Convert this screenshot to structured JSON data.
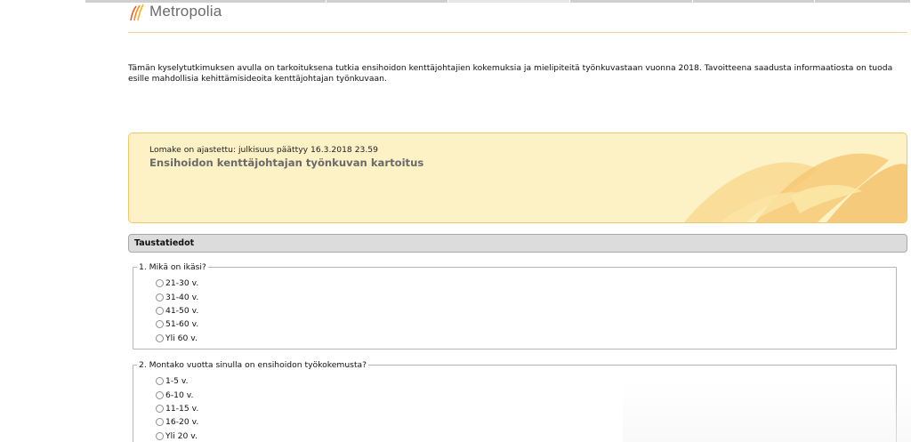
{
  "brand": {
    "name": "Metropolia",
    "accent": "#f0a81e",
    "logo_icon": "metropolia-flame-icon"
  },
  "intro": {
    "text": "Tämän kyselytutkimuksen avulla on tarkoituksena tutkia ensihoidon kenttäjohtajien kokemuksia ja mielipiteitä työnkuvastaan vuonna 2018. Tavoitteena saadusta informaatiosta on tuoda esille mahdollisia kehittämisideoita kenttäjohtajan työnkuvaan."
  },
  "banner": {
    "schedule": "Lomake on ajastettu: julkisuus päättyy 16.3.2018 23.59",
    "title": "Ensihoidon kenttäjohtajan työnkuvan kartoitus",
    "bg": "#fdf1c6"
  },
  "section": {
    "title": "Taustatiedot"
  },
  "questions": [
    {
      "label": "1. Mikä on ikäsi?",
      "options": [
        "21-30 v.",
        "31-40 v.",
        "41-50 v.",
        "51-60 v.",
        "Yli 60 v."
      ]
    },
    {
      "label": "2. Montako vuotta sinulla on ensihoidon työkokemusta?",
      "options": [
        "1-5 v.",
        "6-10 v.",
        "11-15 v.",
        "16-20 v.",
        "Yli 20 v."
      ]
    }
  ]
}
